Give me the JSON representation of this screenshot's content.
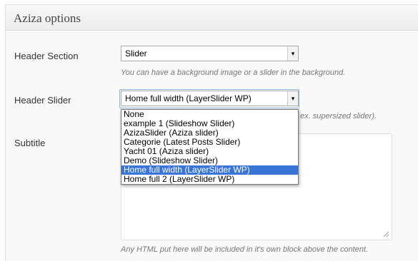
{
  "panel": {
    "title": "Aziza options"
  },
  "header_section": {
    "label": "Header Section",
    "selected": "Slider",
    "hint": "You can have a background image or a slider in the background."
  },
  "header_slider": {
    "label": "Header Slider",
    "selected": "Home full width (LayerSlider WP)",
    "hint_visible": "ex. supersized slider).",
    "options": [
      "None",
      "example 1 (Slideshow Slider)",
      "AzizaSlider (Aziza slider)",
      "Categorie (Latest Posts Slider)",
      "Yacht 01 (Aziza slider)",
      "Demo (Slideshow Slider)",
      "Home full width (LayerSlider WP)",
      "Home full 2 (LayerSlider WP)"
    ],
    "highlighted_index": 6
  },
  "subtitle": {
    "label": "Subtitle",
    "value": "",
    "hint": "Any HTML put here will be included in it's own block above the content."
  },
  "icons": {
    "dropdown_arrow": "chevron-down-icon",
    "resize_grip": "resize-grip-icon"
  },
  "colors": {
    "highlight": "#3875d7",
    "panel_bg": "#f9f9f9",
    "hint_text": "#777777"
  }
}
